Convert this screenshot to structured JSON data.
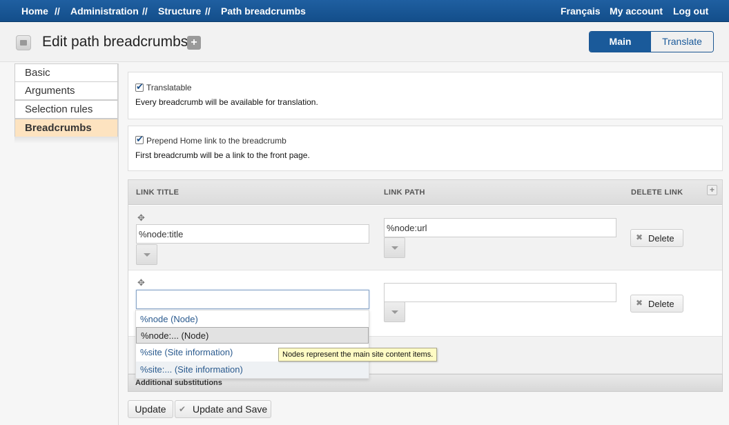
{
  "topbar": {
    "breadcrumbs": [
      "Home",
      "Administration",
      "Structure",
      "Path breadcrumbs"
    ],
    "separator": "//",
    "right": [
      "Français",
      "My account",
      "Log out"
    ]
  },
  "header": {
    "title": "Edit path breadcrumbs",
    "add_label": "+",
    "tabs": [
      {
        "label": "Main",
        "active": true
      },
      {
        "label": "Translate",
        "active": false
      }
    ]
  },
  "sidebar": {
    "items": [
      {
        "label": "Basic",
        "active": false
      },
      {
        "label": "Arguments",
        "active": false
      },
      {
        "label": "Selection rules",
        "active": false
      },
      {
        "label": "Breadcrumbs",
        "active": true
      }
    ]
  },
  "options": {
    "translatable": {
      "label": "Translatable",
      "checked": true,
      "description": "Every breadcrumb will be available for translation."
    },
    "prepend_home": {
      "label": "Prepend Home link to the breadcrumb",
      "checked": true,
      "description": "First breadcrumb will be a link to the front page."
    }
  },
  "table": {
    "headers": {
      "title": "LINK TITLE",
      "path": "LINK PATH",
      "delete": "DELETE LINK"
    },
    "rows": [
      {
        "title": "%node:title",
        "path": "%node:url",
        "delete_label": "Delete"
      },
      {
        "title": "",
        "path": "",
        "delete_label": "Delete"
      }
    ]
  },
  "autocomplete": {
    "items": [
      "%node (Node)",
      "%node:... (Node)",
      "%site (Site information)",
      "%site:... (Site information)"
    ],
    "selected_index": 1
  },
  "tooltip": "Nodes represent the main site content items.",
  "additional": "Additional substitutions",
  "buttons": {
    "update": "Update",
    "update_save": "Update and Save"
  },
  "colors": {
    "topbar": "#1a5a9a",
    "active_sidebar": "#fde3c0",
    "tooltip": "#fffbc4"
  }
}
